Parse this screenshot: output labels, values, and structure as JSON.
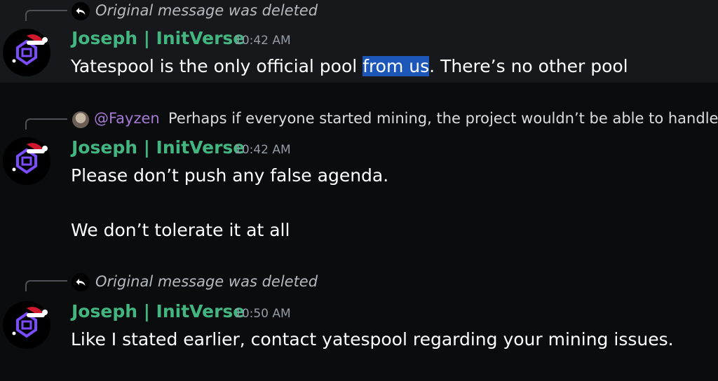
{
  "colors": {
    "background": "#0b0c0e",
    "hovered_message_bg": "#17181b",
    "author_name": "#43b581",
    "timestamp": "#949ba4",
    "message_text": "#ffffff",
    "deleted_reply_text": "#b5bac1",
    "mention": "#a57ad6",
    "selection": "#1b56b8"
  },
  "messages": [
    {
      "reply": {
        "icon": "reply-arrow-icon",
        "text": "Original message was deleted"
      },
      "author": "Joseph | InitVerse",
      "timestamp": "10:42 AM",
      "avatar_icon": "initverse-logo-santa-hat-icon",
      "text_before": "Yatespool is the only official pool ",
      "text_selected": "from us",
      "text_after": ". There’s no other pool"
    },
    {
      "reply": {
        "avatar_icon": "fayzen-avatar-icon",
        "mention": "@Fayzen",
        "preview": "Perhaps if everyone started mining, the project wouldn’t be able to handle"
      },
      "author": "Joseph | InitVerse",
      "timestamp": "10:42 AM",
      "avatar_icon": "initverse-logo-santa-hat-icon",
      "lines": [
        "Please don’t push any false agenda.",
        "We don’t tolerate it at all"
      ]
    },
    {
      "reply": {
        "icon": "reply-arrow-icon",
        "text": "Original message was deleted"
      },
      "author": "Joseph | InitVerse",
      "timestamp": "10:50 AM",
      "avatar_icon": "initverse-logo-santa-hat-icon",
      "text": "Like I stated earlier, contact yatespool regarding your mining issues."
    }
  ]
}
